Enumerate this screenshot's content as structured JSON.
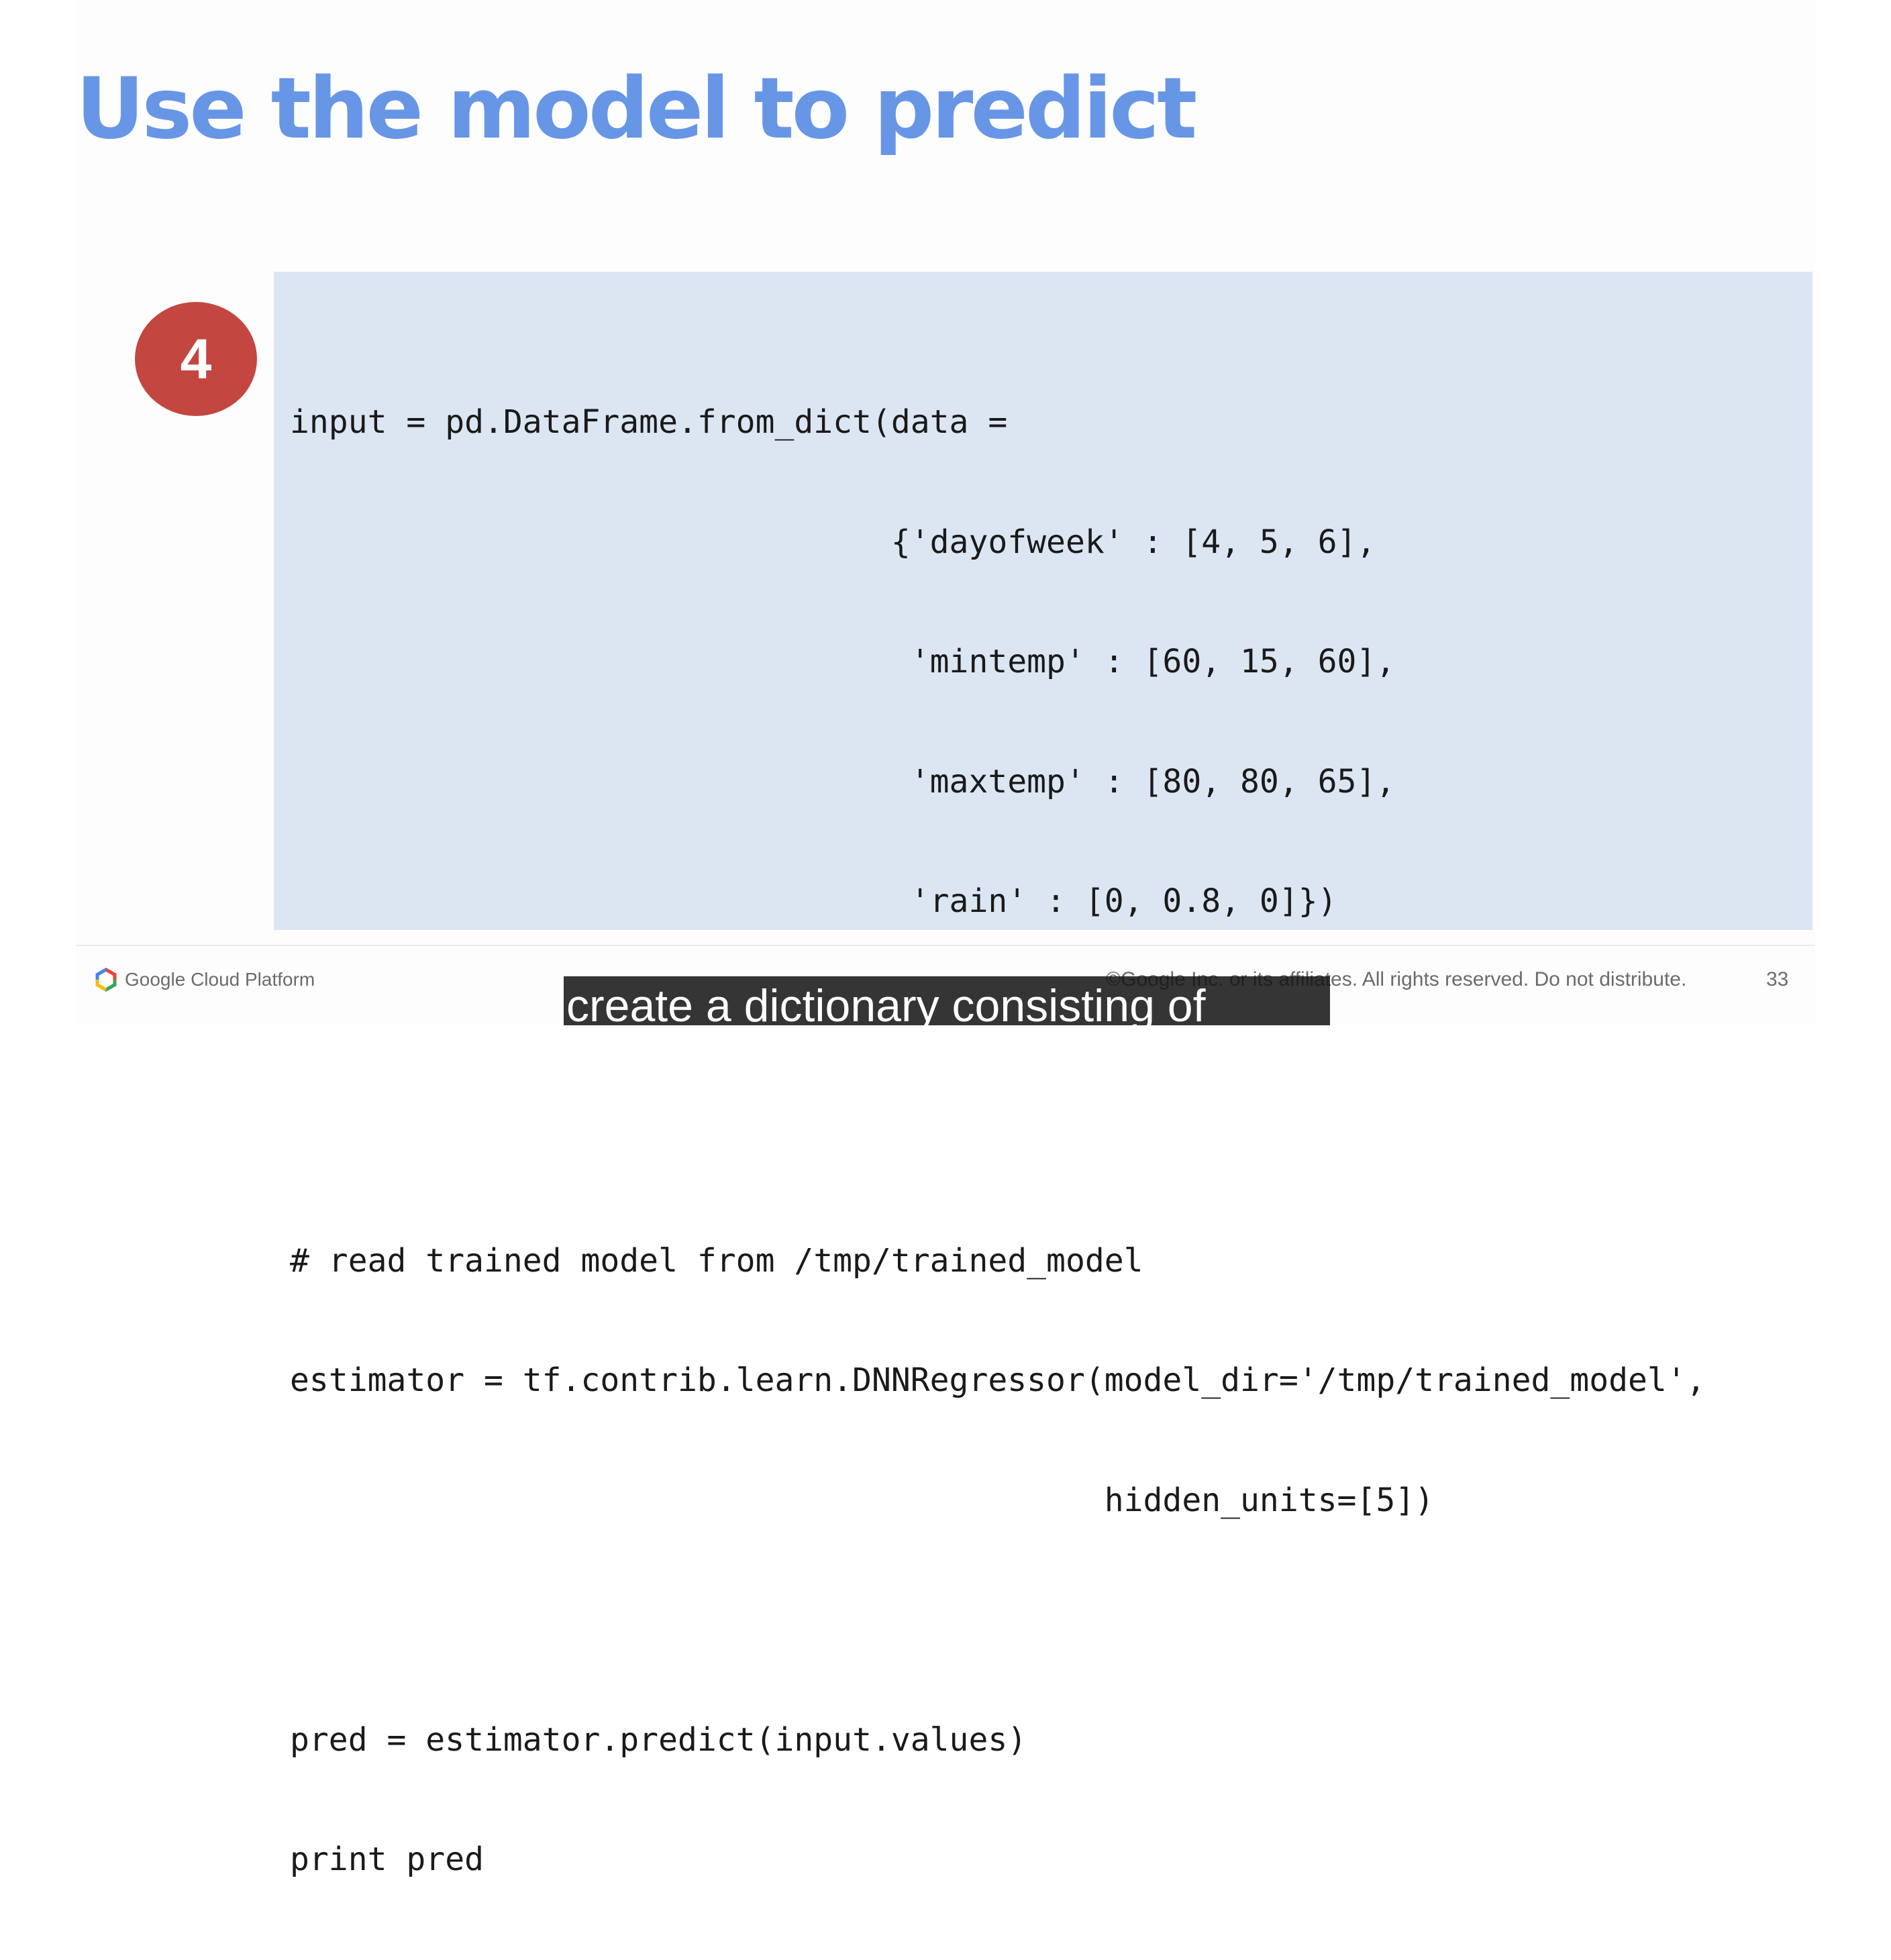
{
  "slide": {
    "title": "Use the model to predict",
    "step_number": "4",
    "code_lines": [
      "input = pd.DataFrame.from_dict(data =",
      "                               {'dayofweek' : [4, 5, 6],",
      "                                'mintemp' : [60, 15, 60],",
      "                                'maxtemp' : [80, 80, 65],",
      "                                'rain' : [0, 0.8, 0]})",
      "",
      "",
      "# read trained model from /tmp/trained_model",
      "estimator = tf.contrib.learn.DNNRegressor(model_dir='/tmp/trained_model',",
      "                                          hidden_units=[5])",
      "",
      "pred = estimator.predict(input.values)",
      "print pred"
    ]
  },
  "footer": {
    "logo_icon": "google-cloud-hexagon-icon",
    "logo_text": "Google Cloud Platform",
    "copyright": "©Google Inc. or its affiliates. All rights reserved. Do not distribute.",
    "page_number": "33"
  },
  "caption": {
    "text": "create a dictionary consisting of"
  },
  "colors": {
    "title": "#6896e6",
    "badge": "#c44641",
    "code_background": "#dce6f3"
  }
}
